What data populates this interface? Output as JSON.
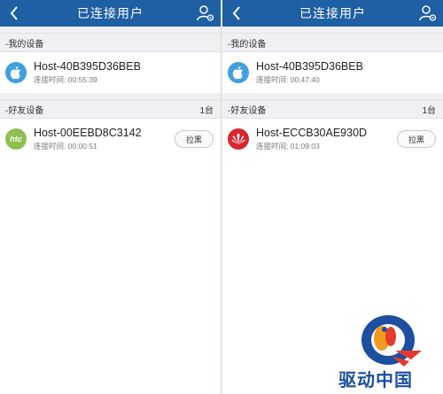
{
  "header": {
    "title": "已连接用户"
  },
  "sections": {
    "my_devices": "-我的设备",
    "friend_devices": "-好友设备"
  },
  "left": {
    "my_device": {
      "host": "Host-40B395D36BEB",
      "time": "连接时间: 00:55:39",
      "icon": "apple-icon"
    },
    "friend_count": "1台",
    "friend_device": {
      "host": "Host-00EEBD8C3142",
      "time": "连接时间: 00:00:51",
      "icon": "htc-icon",
      "block_label": "拉黑"
    }
  },
  "right": {
    "my_device": {
      "host": "Host-40B395D36BEB",
      "time": "连接时间: 00:47:40",
      "icon": "apple-icon"
    },
    "friend_count": "1台",
    "friend_device": {
      "host": "Host-ECCB30AE930D",
      "time": "连接时间: 01:09:03",
      "icon": "huawei-icon",
      "block_label": "拉黑"
    }
  },
  "htc_logo_text": "htc",
  "watermark": {
    "text": "驱动中国"
  },
  "colors": {
    "header": "#1f5fa3",
    "section_bg": "#efeff4",
    "apple": "#3ea1de",
    "htc": "#8fc04f",
    "huawei": "#d8272f",
    "watermark": "#1d4fa0"
  }
}
